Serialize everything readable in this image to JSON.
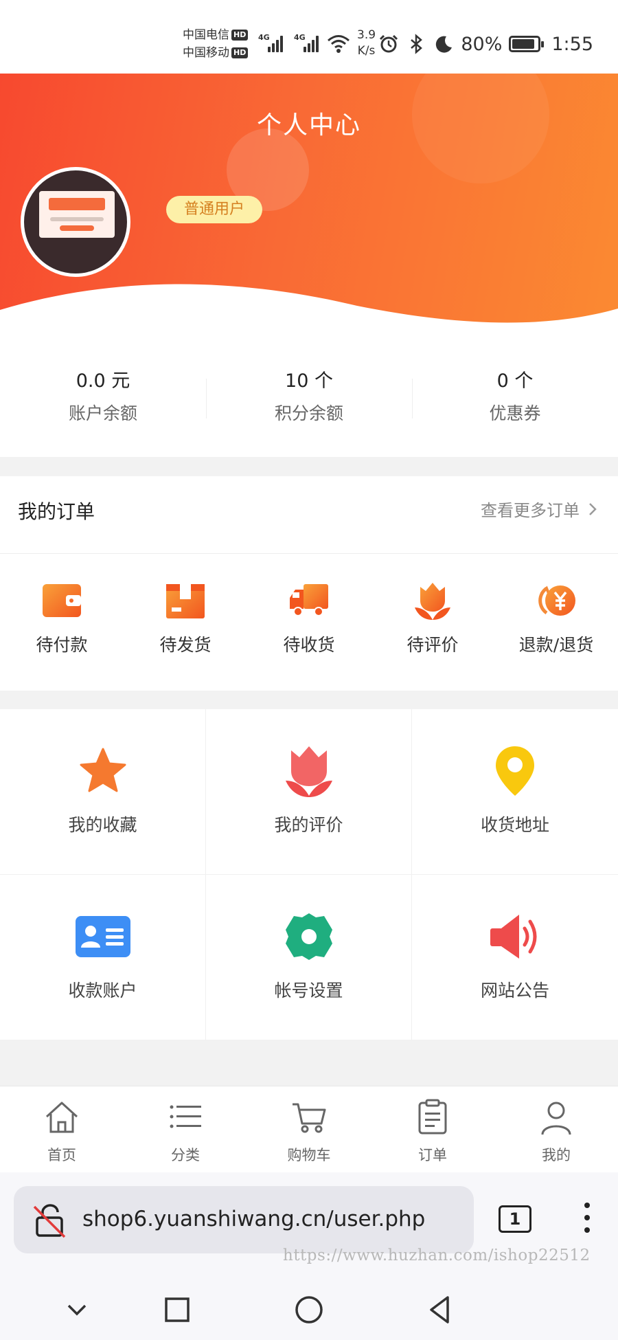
{
  "status_bar": {
    "carrier1": "中国电信",
    "carrier2": "中国移动",
    "hd": "HD",
    "net1": "4G",
    "net2": "4G",
    "speed_value": "3.9",
    "speed_unit": "K/s",
    "battery": "80%",
    "time": "1:55"
  },
  "header": {
    "title": "个人中心",
    "user_level": "普通用户"
  },
  "stats": [
    {
      "value": "0.0 元",
      "label": "账户余额"
    },
    {
      "value": "10 个",
      "label": "积分余额"
    },
    {
      "value": "0 个",
      "label": "优惠券"
    }
  ],
  "orders": {
    "title": "我的订单",
    "more": "查看更多订单",
    "items": [
      {
        "label": "待付款",
        "icon": "wallet-icon"
      },
      {
        "label": "待发货",
        "icon": "box-icon"
      },
      {
        "label": "待收货",
        "icon": "truck-icon"
      },
      {
        "label": "待评价",
        "icon": "flower-icon"
      },
      {
        "label": "退款/退货",
        "icon": "refund-icon"
      }
    ]
  },
  "menu": [
    {
      "label": "我的收藏",
      "icon": "star-icon",
      "color": "#f5792f"
    },
    {
      "label": "我的评价",
      "icon": "flower-icon",
      "color": "#f2545b"
    },
    {
      "label": "收货地址",
      "icon": "location-icon",
      "color": "#f9c80e"
    },
    {
      "label": "收款账户",
      "icon": "id-card-icon",
      "color": "#3d8ef5"
    },
    {
      "label": "帐号设置",
      "icon": "gear-icon",
      "color": "#1fae7f"
    },
    {
      "label": "网站公告",
      "icon": "speaker-icon",
      "color": "#ee4b4b"
    }
  ],
  "tabbar": [
    {
      "label": "首页",
      "icon": "home-icon"
    },
    {
      "label": "分类",
      "icon": "list-icon"
    },
    {
      "label": "购物车",
      "icon": "cart-icon"
    },
    {
      "label": "订单",
      "icon": "clipboard-icon"
    },
    {
      "label": "我的",
      "icon": "user-icon"
    }
  ],
  "browser": {
    "url": "shop6.yuanshiwang.cn/user.php",
    "tab_count": "1",
    "watermark": "https://www.huzhan.com/ishop22512"
  },
  "colors": {
    "accent_start": "#f7492f",
    "accent_end": "#fb8a32",
    "badge_bg": "#fdf0a8",
    "badge_text": "#d58020"
  }
}
